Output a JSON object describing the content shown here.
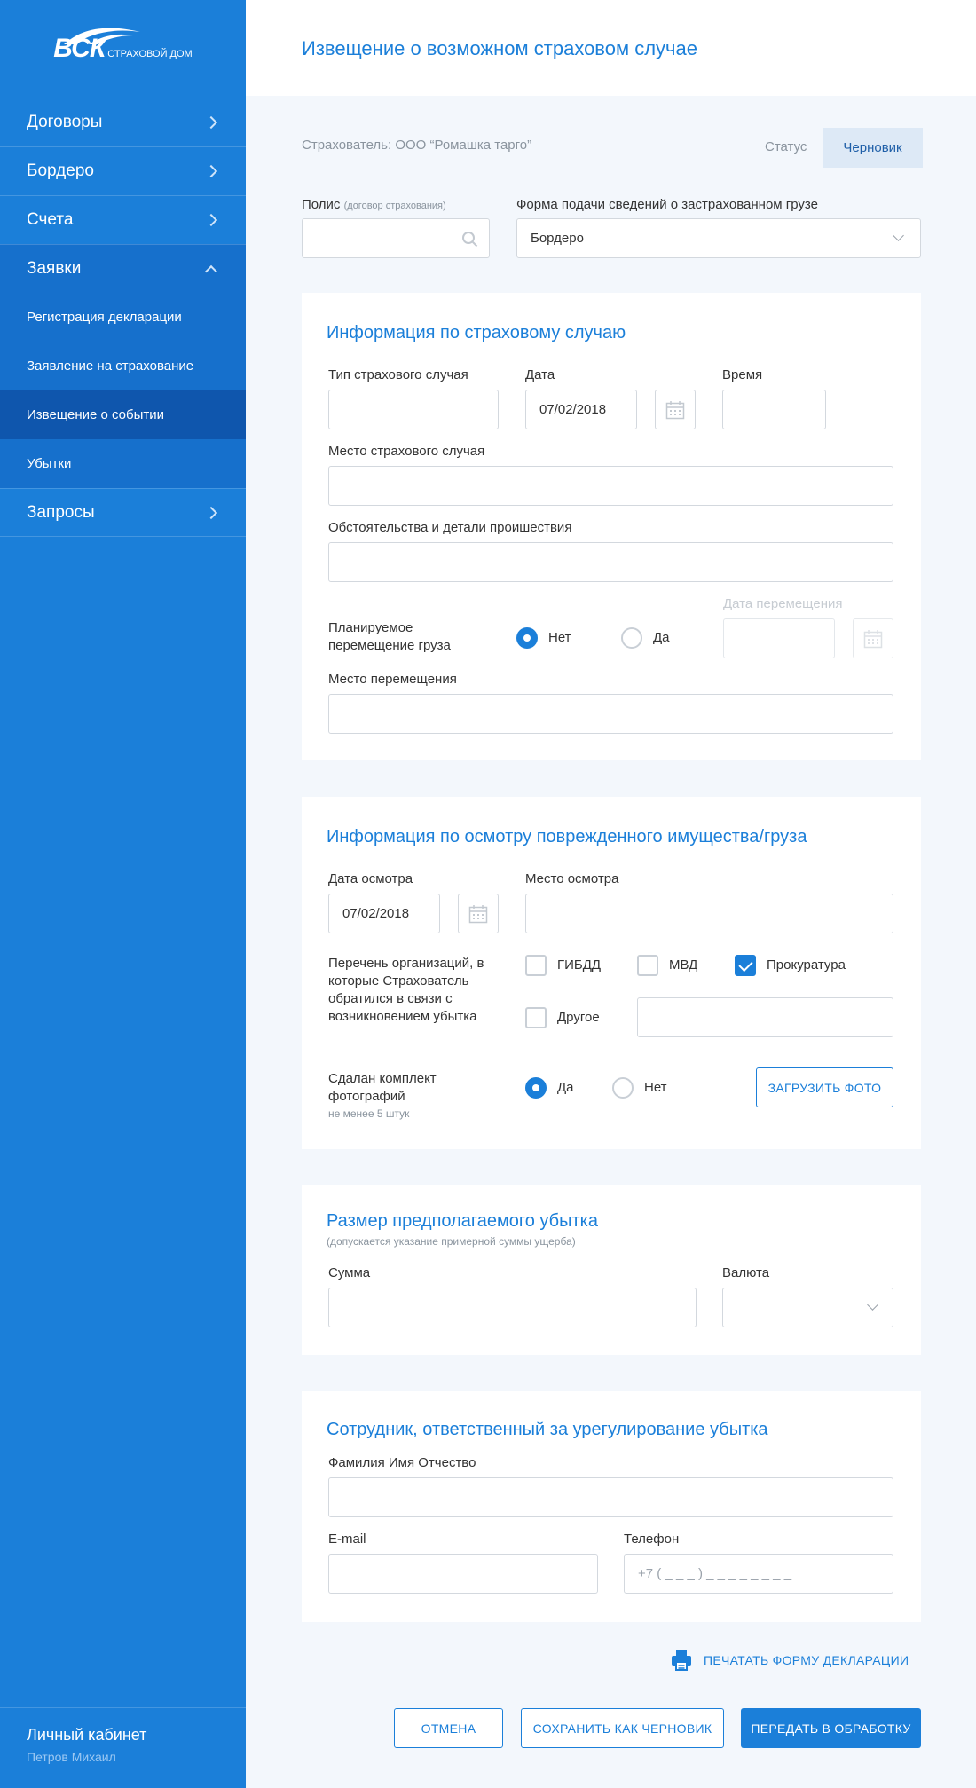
{
  "colors": {
    "brand": "#1b7fd9",
    "sidebar_active": "#0f56ad",
    "sidebar_open": "#1670cc"
  },
  "logo": {
    "main": "ВСК",
    "sub": "СТРАХОВОЙ ДОМ"
  },
  "sidebar": {
    "items": [
      {
        "label": "Договоры",
        "icon": "chevron-right-icon"
      },
      {
        "label": "Бордеро",
        "icon": "chevron-right-icon"
      },
      {
        "label": "Счета",
        "icon": "chevron-right-icon"
      },
      {
        "label": "Заявки",
        "icon": "chevron-up-icon"
      },
      {
        "label": "Запросы",
        "icon": "chevron-right-icon"
      }
    ],
    "sub_items": [
      {
        "label": "Регистрация декларации"
      },
      {
        "label": "Заявление на страхование"
      },
      {
        "label": "Извещение о событии",
        "active": true
      },
      {
        "label": "Убытки"
      }
    ],
    "account": {
      "title": "Личный кабинет",
      "user": "Петров Михаил"
    }
  },
  "header": {
    "title": "Извещение о возможном страховом случае"
  },
  "top": {
    "insurer": "Страхователь: ООО “Ромашка тарго”",
    "status_label": "Статус",
    "status_value": "Черновик",
    "policy_label": "Полис",
    "policy_hint": "(договор страхования)",
    "policy_value": "",
    "form_label": "Форма подачи сведений о застрахованном грузе",
    "form_value": "Бордеро"
  },
  "case": {
    "title": "Информация по страховому случаю",
    "type_label": "Тип страхового случая",
    "type_value": "",
    "date_label": "Дата",
    "date_value": "07/02/2018",
    "time_label": "Время",
    "time_value": "",
    "place_label": "Место страхового случая",
    "place_value": "",
    "details_label": "Обстоятельства и детали проишествия",
    "details_value": "",
    "move_label": "Планируемое перемещение груза",
    "move_no": "Нет",
    "move_yes": "Да",
    "move_selected": "Нет",
    "move_date_label": "Дата перемещения",
    "move_date_value": "",
    "move_place_label": "Место перемещения",
    "move_place_value": ""
  },
  "inspection": {
    "title": "Информация по осмотру поврежденного имущества/груза",
    "date_label": "Дата осмотра",
    "date_value": "07/02/2018",
    "place_label": "Место осмотра",
    "place_value": "",
    "orgs_label": "Перечень организаций, в которые Страхователь обратился в связи с возникновением убытка",
    "orgs": [
      {
        "label": "ГИБДД",
        "checked": false
      },
      {
        "label": "МВД",
        "checked": false
      },
      {
        "label": "Прокуратура",
        "checked": true
      },
      {
        "label": "Другое",
        "checked": false
      }
    ],
    "other_value": "",
    "photos_label": "Сдалан комплект фотографий",
    "photos_hint": "не менее 5 штук",
    "photos_yes": "Да",
    "photos_no": "Нет",
    "photos_selected": "Да",
    "upload_button": "ЗАГРУЗИТЬ ФОТО"
  },
  "loss": {
    "title": "Размер предполагаемого убытка",
    "subtitle": "(допускается указание примерной суммы ущерба)",
    "sum_label": "Сумма",
    "sum_value": "",
    "currency_label": "Валюта",
    "currency_value": ""
  },
  "employee": {
    "title": "Сотрудник, ответственный за урегулирование убытка",
    "name_label": "Фамилия Имя Отчество",
    "name_value": "",
    "email_label": "E-mail",
    "email_value": "",
    "phone_label": "Телефон",
    "phone_placeholder": "+7 ( _ _ _ ) _ _ _ _ _ _ _ _"
  },
  "actions": {
    "print": "ПЕЧАТАТЬ ФОРМУ ДЕКЛАРАЦИИ",
    "cancel": "ОТМЕНА",
    "save_draft": "СОХРАНИТЬ КАК ЧЕРНОВИК",
    "submit": "ПЕРЕДАТЬ В ОБРАБОТКУ"
  }
}
